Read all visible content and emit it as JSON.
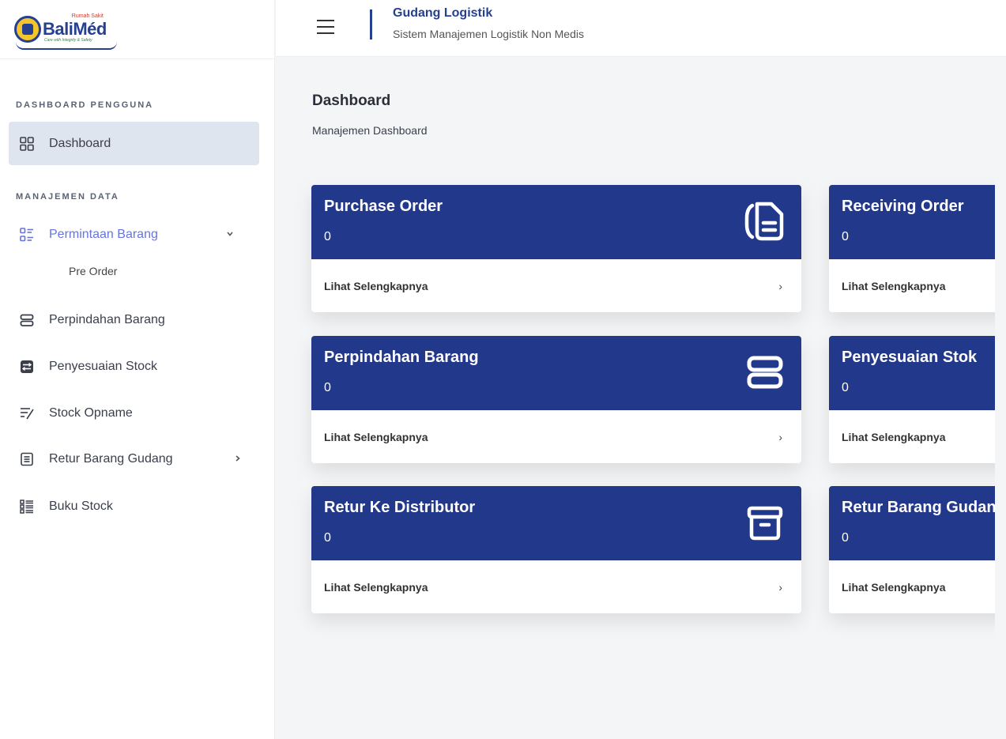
{
  "logo": {
    "small": "Rumah Sakit",
    "name": "BaliMéd",
    "tagline": "Care with Integrity & Safety"
  },
  "header": {
    "title": "Gudang Logistik",
    "subtitle": "Sistem Manajemen Logistik Non Medis"
  },
  "sidebar": {
    "section1": "DASHBOARD PENGGUNA",
    "section2": "MANAJEMEN DATA",
    "items": [
      {
        "label": "Dashboard",
        "icon": "grid-icon"
      },
      {
        "label": "Permintaan Barang",
        "icon": "list-icon"
      },
      {
        "label": "Pre Order"
      },
      {
        "label": "Perpindahan Barang",
        "icon": "server-icon"
      },
      {
        "label": "Penyesuaian Stock",
        "icon": "adjust-icon"
      },
      {
        "label": "Stock Opname",
        "icon": "checklist-icon"
      },
      {
        "label": "Retur Barang Gudang",
        "icon": "document-icon"
      },
      {
        "label": "Buku Stock",
        "icon": "ledger-icon"
      }
    ]
  },
  "main": {
    "title": "Dashboard",
    "subtitle": "Manajemen Dashboard",
    "cards": [
      {
        "title": "Purchase Order",
        "count": "0",
        "link": "Lihat Selengkapnya",
        "icon": "document-icon"
      },
      {
        "title": "Receiving Order",
        "count": "0",
        "link": "Lihat Selengkapnya"
      },
      {
        "title": "Perpindahan Barang",
        "count": "0",
        "link": "Lihat Selengkapnya",
        "icon": "server-icon"
      },
      {
        "title": "Penyesuaian Stok",
        "count": "0",
        "link": "Lihat Selengkapnya"
      },
      {
        "title": "Retur Ke Distributor",
        "count": "0",
        "link": "Lihat Selengkapnya",
        "icon": "archive-icon"
      },
      {
        "title": "Retur Barang Gudang",
        "count": "0",
        "link": "Lihat Selengkapnya"
      }
    ]
  },
  "colors": {
    "primary": "#22388a",
    "active_bg": "#dfe5ee",
    "open_link": "#6674e0"
  }
}
